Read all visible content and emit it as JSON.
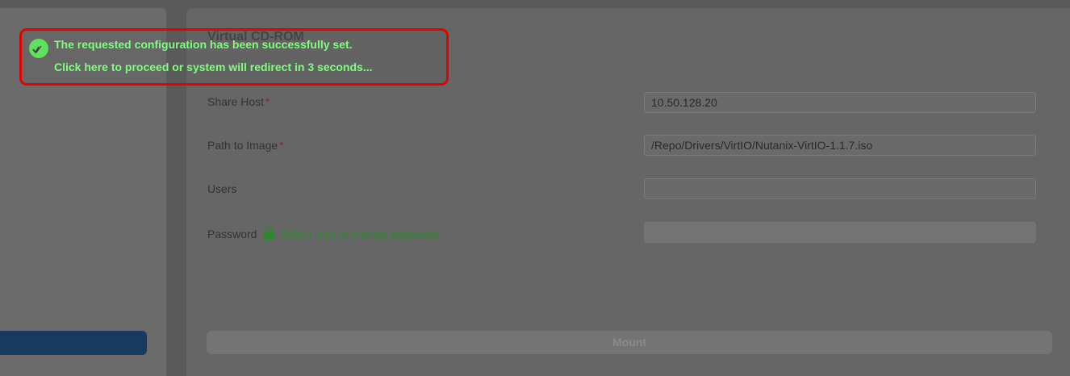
{
  "section": {
    "title": "Virtual CD-ROM"
  },
  "form": {
    "share_host_label": "Share Host",
    "share_host_value": "10.50.128.20",
    "path_label": "Path to Image",
    "path_value": "/Repo/Drivers/VirtIO/Nutanix-VirtIO-1.1.7.iso",
    "users_label": "Users",
    "users_value": "",
    "password_label": "Password",
    "password_hint": "Select icon to change password",
    "required_mark": "*"
  },
  "actions": {
    "mount_label": "Mount"
  },
  "toast": {
    "line1": "The requested configuration has been successfully set.",
    "line2": "Click here to proceed or system will redirect in 3 seconds..."
  },
  "colors": {
    "toast_text": "#7dff7d",
    "toast_border": "#e60000",
    "sidebar_button": "#173a5e",
    "password_hint": "#2c8a2c"
  },
  "icons": {
    "toast": "check-circle-icon",
    "password": "lock-icon"
  }
}
